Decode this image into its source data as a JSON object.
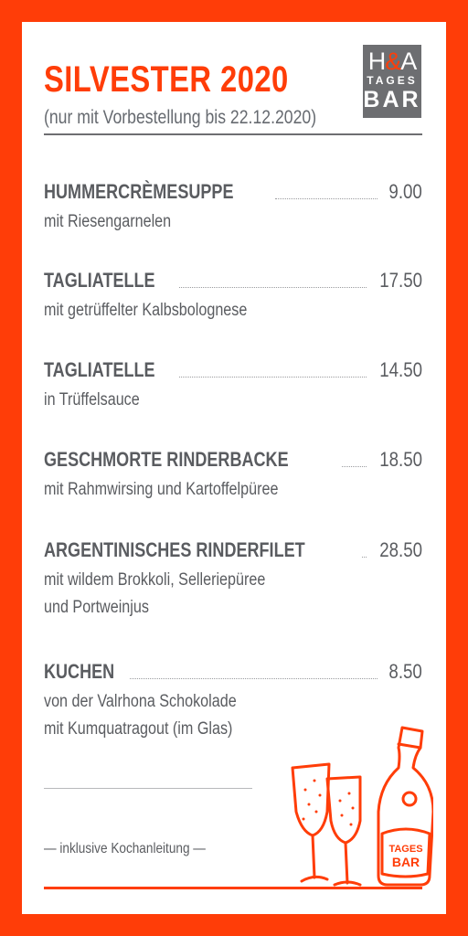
{
  "header": {
    "title": "SILVESTER 2020",
    "subtitle": "(nur mit Vorbestellung bis 22.12.2020)"
  },
  "logo": {
    "line1_left": "H",
    "line1_amp": "&",
    "line1_right": "A",
    "line2": "TAGES",
    "line3": "BAR"
  },
  "menu": [
    {
      "name": "HUMMERCRÈMESUPPE",
      "price": "9.00",
      "desc": [
        "mit Riesengarnelen"
      ]
    },
    {
      "name": "TAGLIATELLE",
      "price": "17.50",
      "desc": [
        "mit getrüffelter Kalbsbolognese"
      ]
    },
    {
      "name": "TAGLIATELLE",
      "price": "14.50",
      "desc": [
        "in Trüffelsauce"
      ]
    },
    {
      "name": "GESCHMORTE RINDERBACKE",
      "price": "18.50",
      "desc": [
        "mit Rahmwirsing und Kartoffelpüree"
      ]
    },
    {
      "name": "ARGENTINISCHES RINDERFILET",
      "price": "28.50",
      "desc": [
        "mit wildem Brokkoli, Selleriepüree",
        "und Portweinjus"
      ]
    },
    {
      "name": "KUCHEN",
      "price": "8.50",
      "desc": [
        "von der Valrhona Schokolade",
        "mit Kumquatragout (im Glas)"
      ]
    }
  ],
  "footer": {
    "note": "— inklusive Kochanleitung —",
    "bottle_label_1": "TAGES",
    "bottle_label_2": "BAR"
  },
  "colors": {
    "accent": "#ff3d08",
    "text": "#5a5c60",
    "logo_bg": "#6d6e71",
    "background": "#ffffff"
  },
  "icons": [
    "champagne-glass-icon",
    "champagne-bottle-icon"
  ]
}
